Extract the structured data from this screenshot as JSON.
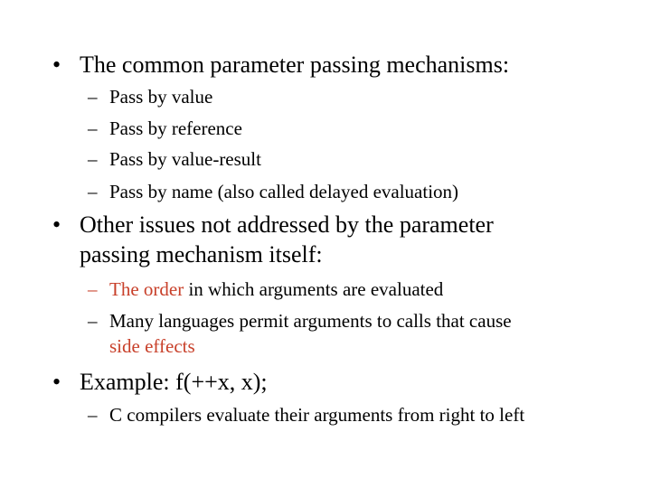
{
  "slide": {
    "bullets": [
      {
        "text": "The common parameter passing mechanisms:",
        "sub": [
          "Pass by value",
          "Pass by reference",
          "Pass by value-result",
          "Pass by name (also called delayed evaluation)"
        ]
      },
      {
        "line1": "Other issues not addressed by the parameter",
        "line2": "passing mechanism itself:",
        "sub1": {
          "highlight": "The order",
          "rest": " in which arguments are evaluated"
        },
        "sub2": {
          "line1": "Many languages permit arguments to calls that cause",
          "highlight": "side effects"
        }
      },
      {
        "text": "Example: f(++x, x);",
        "sub": [
          "C compilers evaluate their arguments from right to left"
        ]
      }
    ],
    "bullet_glyph": "•",
    "dash_glyph": "–",
    "highlight_color": "#c8402a"
  }
}
